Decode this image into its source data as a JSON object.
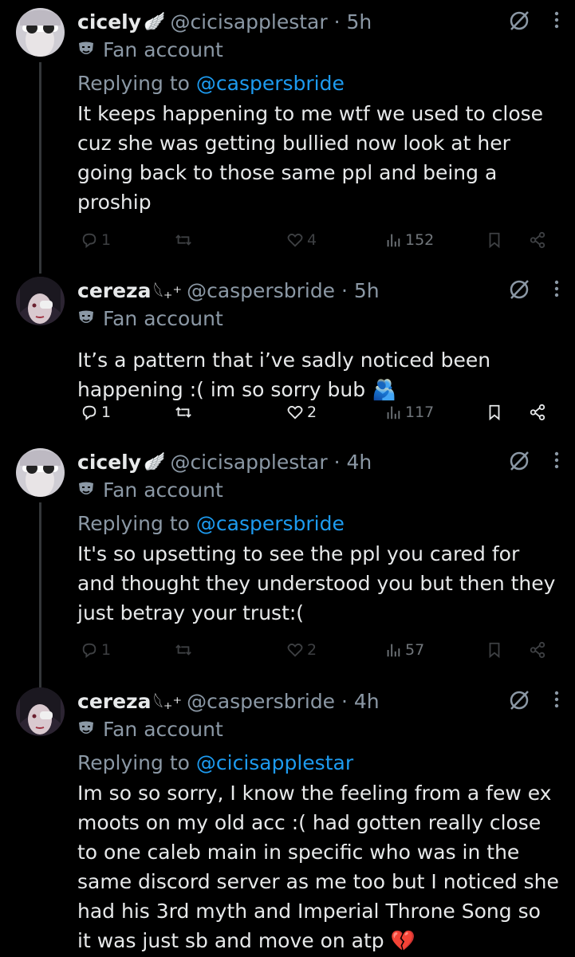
{
  "tweets": [
    {
      "name": "cicely",
      "badge": "🪽",
      "handle": "@cicisapplestar · 5h",
      "fan": "Fan account",
      "replying_prefix": "Replying to ",
      "replying_to": "@caspersbride",
      "text": "It keeps happening to me wtf we used to close cuz she was getting bullied now look at her going back to those same ppl and being a proship",
      "replies": "1",
      "retweets": "",
      "likes": "4",
      "views": "152",
      "avatar_color": "#c9c7cf"
    },
    {
      "name": "cereza",
      "badge": "𓆩₊⁺",
      "handle": "@caspersbride · 5h",
      "fan": "Fan account",
      "replying_prefix": "",
      "replying_to": "",
      "text": "It’s a pattern that i’ve sadly noticed been happening :( im so sorry bub 🫂",
      "replies": "1",
      "retweets": "",
      "likes": "2",
      "views": "117",
      "avatar_color": "#2a2230"
    },
    {
      "name": "cicely",
      "badge": "🪽",
      "handle": "@cicisapplestar · 4h",
      "fan": "Fan account",
      "replying_prefix": "Replying to ",
      "replying_to": "@caspersbride",
      "text": "It's so upsetting to see the ppl you cared for and thought they understood you but then they just betray your trust:(",
      "replies": "1",
      "retweets": "",
      "likes": "2",
      "views": "57",
      "avatar_color": "#c9c7cf"
    },
    {
      "name": "cereza",
      "badge": "𓆩₊⁺",
      "handle": "@caspersbride · 4h",
      "fan": "Fan account",
      "replying_prefix": "Replying to ",
      "replying_to": "@cicisapplestar",
      "text": "Im so so sorry, I know the feeling from a few ex moots on my old acc :( had gotten really close to one caleb main in specific who was in the same discord server as me too but I noticed she had his 3rd myth and Imperial Throne Song so it was just sb and move on atp 💔",
      "replies": "",
      "retweets": "",
      "likes": "",
      "views": "",
      "avatar_color": "#2a2230"
    }
  ],
  "colors": {
    "accent": "#1d9bf0",
    "muted": "#8b98a5",
    "text": "#e7e9ea",
    "background": "#000000"
  },
  "icons": [
    "reply-icon",
    "retweet-icon",
    "like-icon",
    "views-icon",
    "bookmark-icon",
    "share-icon",
    "grok-icon",
    "more-icon",
    "theater-mask-icon"
  ]
}
